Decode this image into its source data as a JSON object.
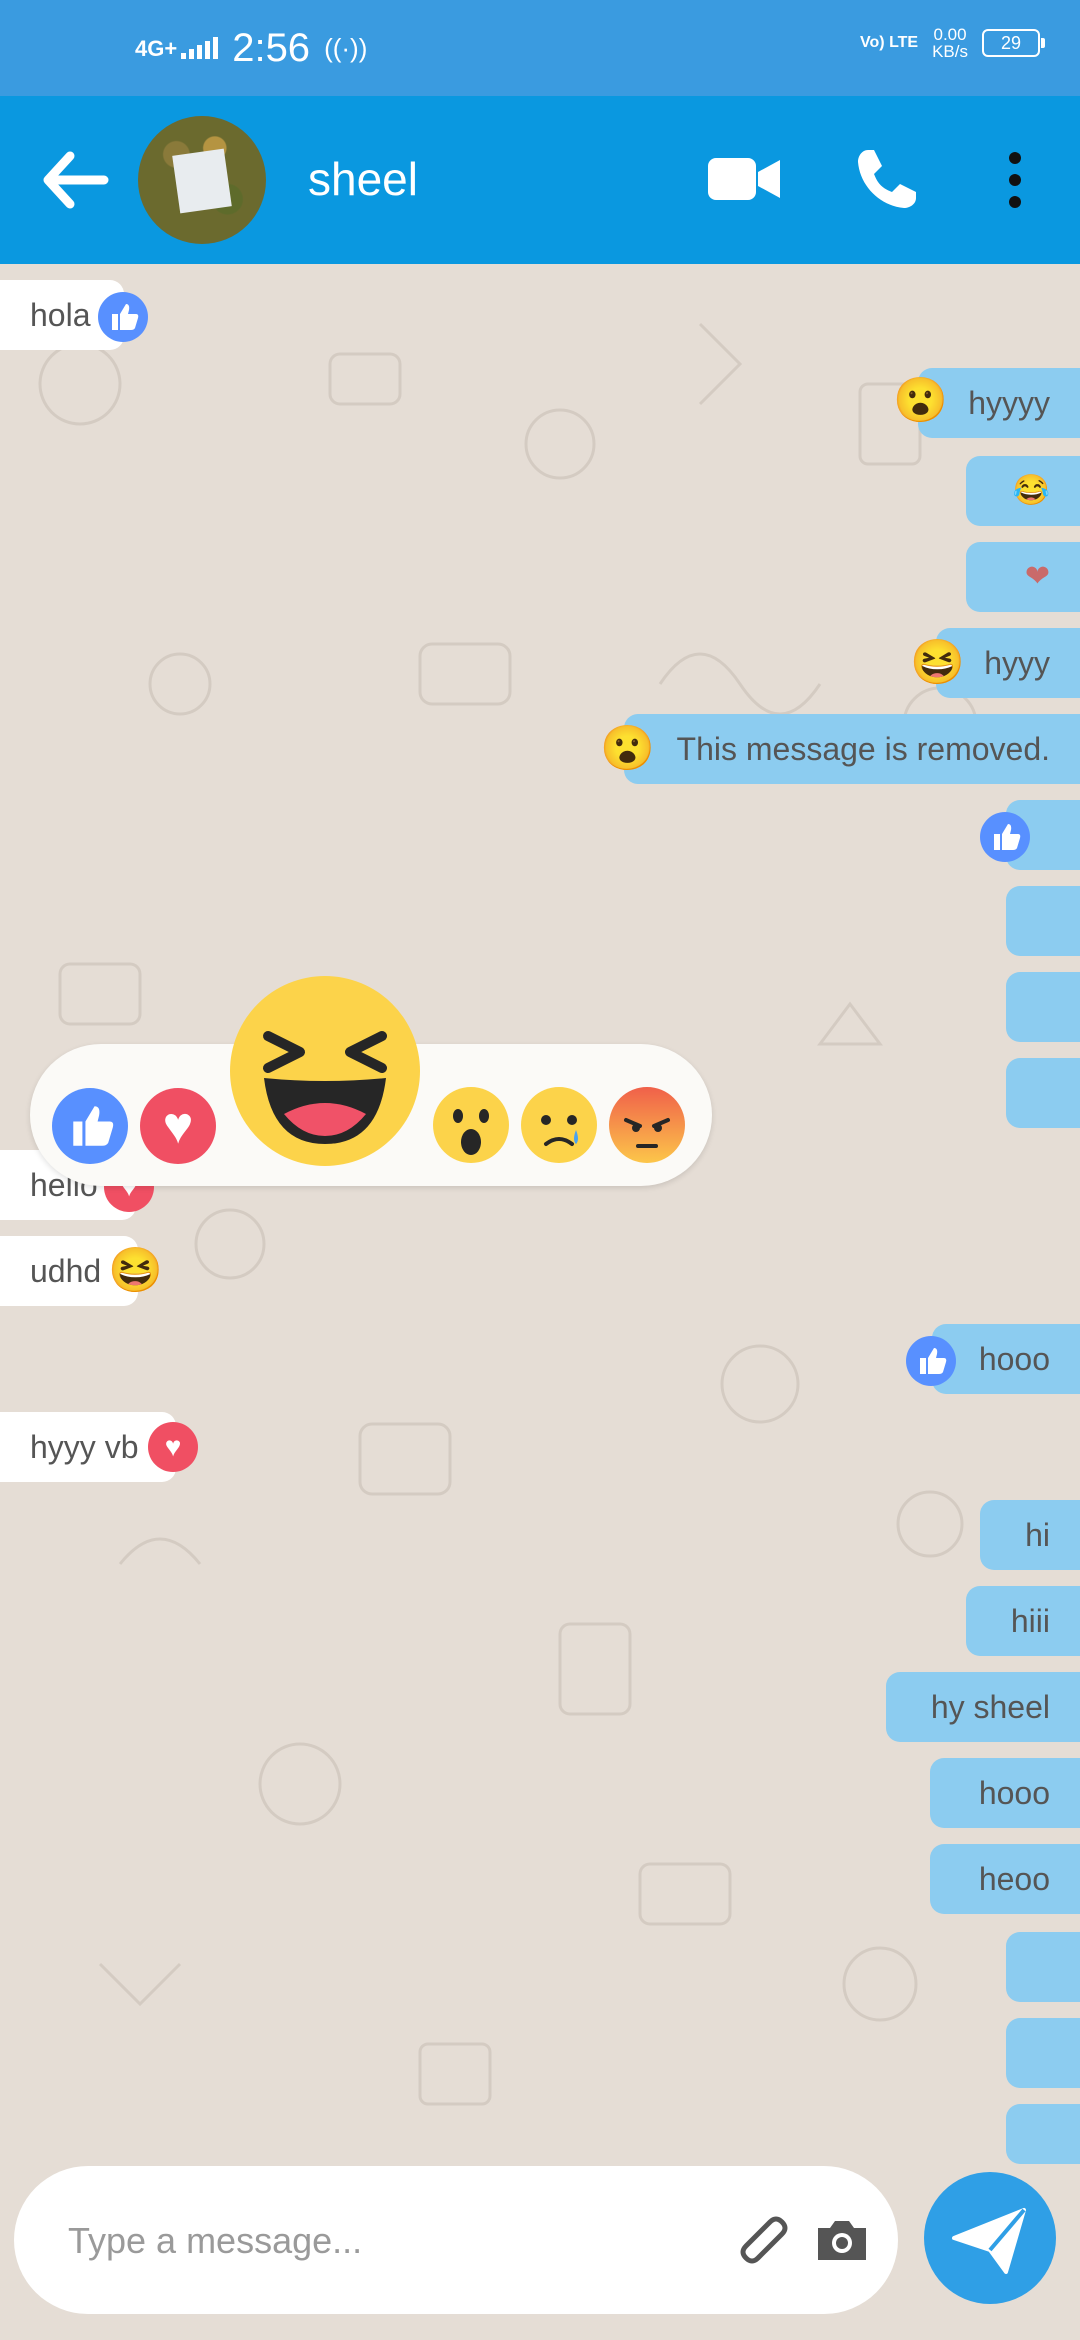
{
  "status_bar": {
    "network": "4G+",
    "time": "2:56",
    "hotspot_icon": "hotspot-icon",
    "volte": "Vo) LTE",
    "speed": "0.00",
    "speed_unit": "KB/s",
    "battery": "29"
  },
  "header": {
    "contact_name": "sheel",
    "back_icon": "arrow-left-icon",
    "video_icon": "video-call-icon",
    "call_icon": "phone-icon",
    "menu_icon": "more-vertical-icon"
  },
  "messages": [
    {
      "side": "in",
      "text": "hola",
      "reaction": "like"
    },
    {
      "side": "out",
      "text": "hyyyy",
      "reaction": "wow"
    },
    {
      "side": "out",
      "text": "😂",
      "reaction": ""
    },
    {
      "side": "out",
      "text": "❤",
      "reaction": ""
    },
    {
      "side": "out",
      "text": "hyyy",
      "reaction": "haha"
    },
    {
      "side": "out",
      "text": "This message is removed.",
      "reaction": "wow"
    },
    {
      "side": "out",
      "text": "",
      "reaction": "like"
    },
    {
      "side": "out",
      "text": "",
      "reaction": ""
    },
    {
      "side": "out",
      "text": "",
      "reaction": ""
    },
    {
      "side": "out",
      "text": "",
      "reaction": ""
    },
    {
      "side": "in",
      "text": "hello",
      "reaction": "love"
    },
    {
      "side": "in",
      "text": "udhd",
      "reaction": "haha"
    },
    {
      "side": "out",
      "text": "hooo",
      "reaction": "like"
    },
    {
      "side": "in",
      "text": "hyyy vb",
      "reaction": "love"
    },
    {
      "side": "out",
      "text": "hi",
      "reaction": ""
    },
    {
      "side": "out",
      "text": "hiii",
      "reaction": ""
    },
    {
      "side": "out",
      "text": "hy sheel",
      "reaction": ""
    },
    {
      "side": "out",
      "text": "hooo",
      "reaction": ""
    },
    {
      "side": "out",
      "text": "heoo",
      "reaction": ""
    },
    {
      "side": "out",
      "text": "",
      "reaction": ""
    },
    {
      "side": "out",
      "text": "",
      "reaction": ""
    },
    {
      "side": "out",
      "text": "",
      "reaction": ""
    }
  ],
  "reaction_picker": {
    "options": [
      "like",
      "love",
      "haha",
      "wow",
      "sad",
      "angry"
    ],
    "selected": "haha"
  },
  "composer": {
    "placeholder": "Type a message...",
    "attach_icon": "paperclip-icon",
    "camera_icon": "camera-icon",
    "send_icon": "send-icon"
  },
  "colors": {
    "status_bar": "#3a9be0",
    "app_bar": "#0a98e0",
    "outgoing_bubble": "#8cccf0",
    "incoming_bubble": "#ffffff",
    "chat_background": "#e5ddd5",
    "like": "#5890ff",
    "love": "#f04f63",
    "send_button": "#2f9fe6"
  }
}
